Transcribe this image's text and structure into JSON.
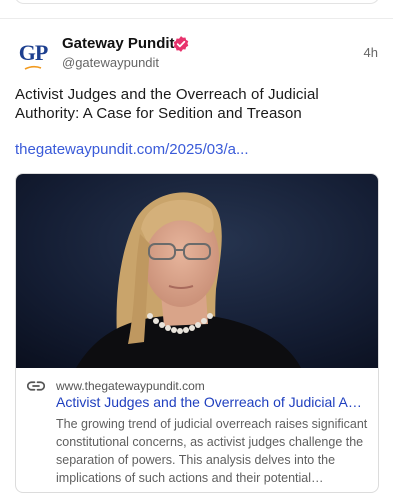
{
  "post": {
    "author_name": "Gateway Pundit",
    "handle": "@gatewaypundit",
    "timestamp": "4h",
    "avatar_initials": "GP",
    "text": "Activist Judges and the Overreach of Judicial Authority: A Case for Sedition and Treason",
    "link_text": "thegatewaypundit.com/2025/03/a..."
  },
  "link_card": {
    "domain": "www.thegatewaypundit.com",
    "title": "Activist Judges and the Overreach of Judicial Authority: A Case for Sedition and Treason",
    "description": "The growing trend of judicial overreach raises significant constitutional concerns, as activist judges challenge the separation of powers. This analysis delves into the implications of such actions and their potential consequences."
  },
  "icons": {
    "verified": "verified-badge-icon",
    "link": "link-icon"
  },
  "colors": {
    "verified_badge": "#e8336d",
    "link": "#3a5bd9",
    "card_title": "#1f3fbf",
    "avatar_brand": "#1d3f8f",
    "avatar_accent": "#f29a1f"
  }
}
